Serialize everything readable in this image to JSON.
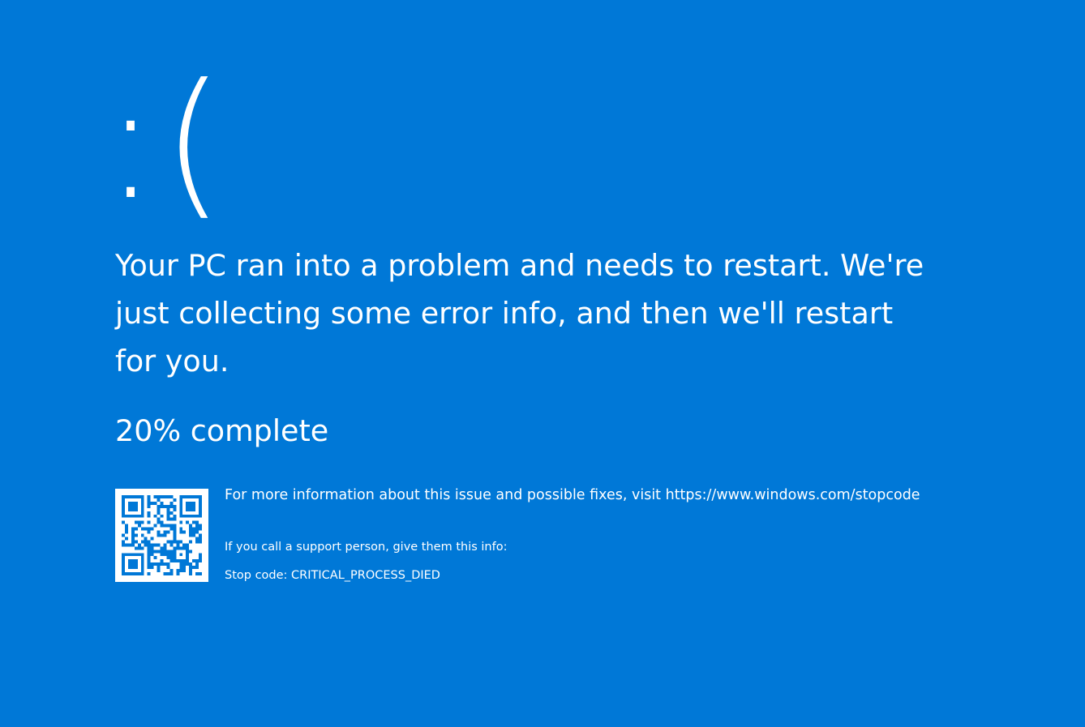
{
  "screen": {
    "background_color": "#0078D7",
    "text_color": "#FFFFFF",
    "sad_face": ":(",
    "message": "Your PC ran into a problem and needs to restart. We're just collecting some error info, and then we'll restart for you.",
    "progress_text": "20% complete",
    "progress_percent": 20,
    "more_info_text": "For more information about this issue and possible fixes, visit https://www.windows.com/stopcode",
    "support_text": "If you call a support person, give them this info:",
    "stop_code_text": "Stop code: CRITICAL_PROCESS_DIED",
    "qr_icon": "qr-code-icon"
  }
}
